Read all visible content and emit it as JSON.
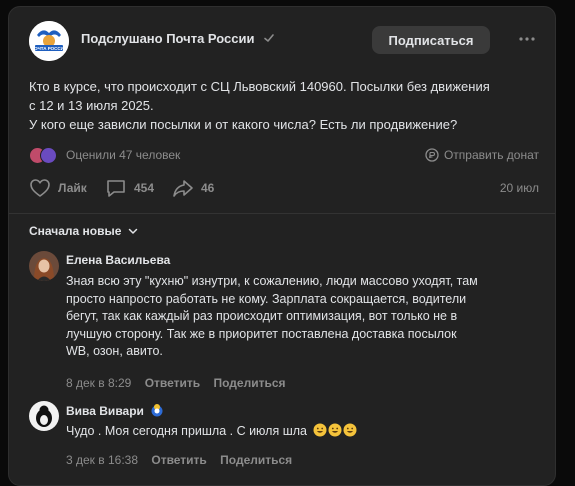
{
  "post": {
    "community_name": "Подслушано Почта России",
    "avatar_text": "ПОЧТА РОССИИ",
    "subscribe_label": "Подписаться",
    "text_lines": [
      "Кто в курсе, что происходит с СЦ Львовский 140960. Посылки без движения",
      "с 12 и 13 июля 2025.",
      "У кого еще зависли посылки и от какого числа? Есть ли продвижение?"
    ],
    "rated_text": "Оценили 47 человек",
    "donate_label": "Отправить донат",
    "like_label": "Лайк",
    "comments_count": "454",
    "shares_count": "46",
    "date": "20 июл"
  },
  "comments_sort": {
    "label": "Сначала новые"
  },
  "comments": [
    {
      "author": "Елена Васильева",
      "text_lines": [
        "Зная всю эту \"кухню\" изнутри, к сожалению, люди массово уходят, там",
        "просто напросто работать не кому. Зарплата сокращается, водители",
        "бегут, так как каждый раз происходит оптимизация, вот только не в",
        "лучшую сторону. Так же в приоритет поставлена доставка посылок",
        "WB, озон, авито."
      ],
      "date": "8 дек в 8:29",
      "reply_label": "Ответить",
      "share_label": "Поделиться"
    },
    {
      "author": "Вива Вивари",
      "text": "Чудо . Моя сегодня пришла . С июля шла",
      "date": "3 дек в 16:38",
      "reply_label": "Ответить",
      "share_label": "Поделиться"
    }
  ],
  "colors": {
    "card_bg": "#222222",
    "text_primary": "#e1e3e6",
    "text_secondary": "#8c8c8c",
    "button_bg": "#3a3a3a"
  },
  "icons": [
    "verified-icon",
    "more-icon",
    "donate-icon",
    "heart-icon",
    "comment-icon",
    "share-icon",
    "chevron-down-icon",
    "smile-emoji-icon"
  ]
}
